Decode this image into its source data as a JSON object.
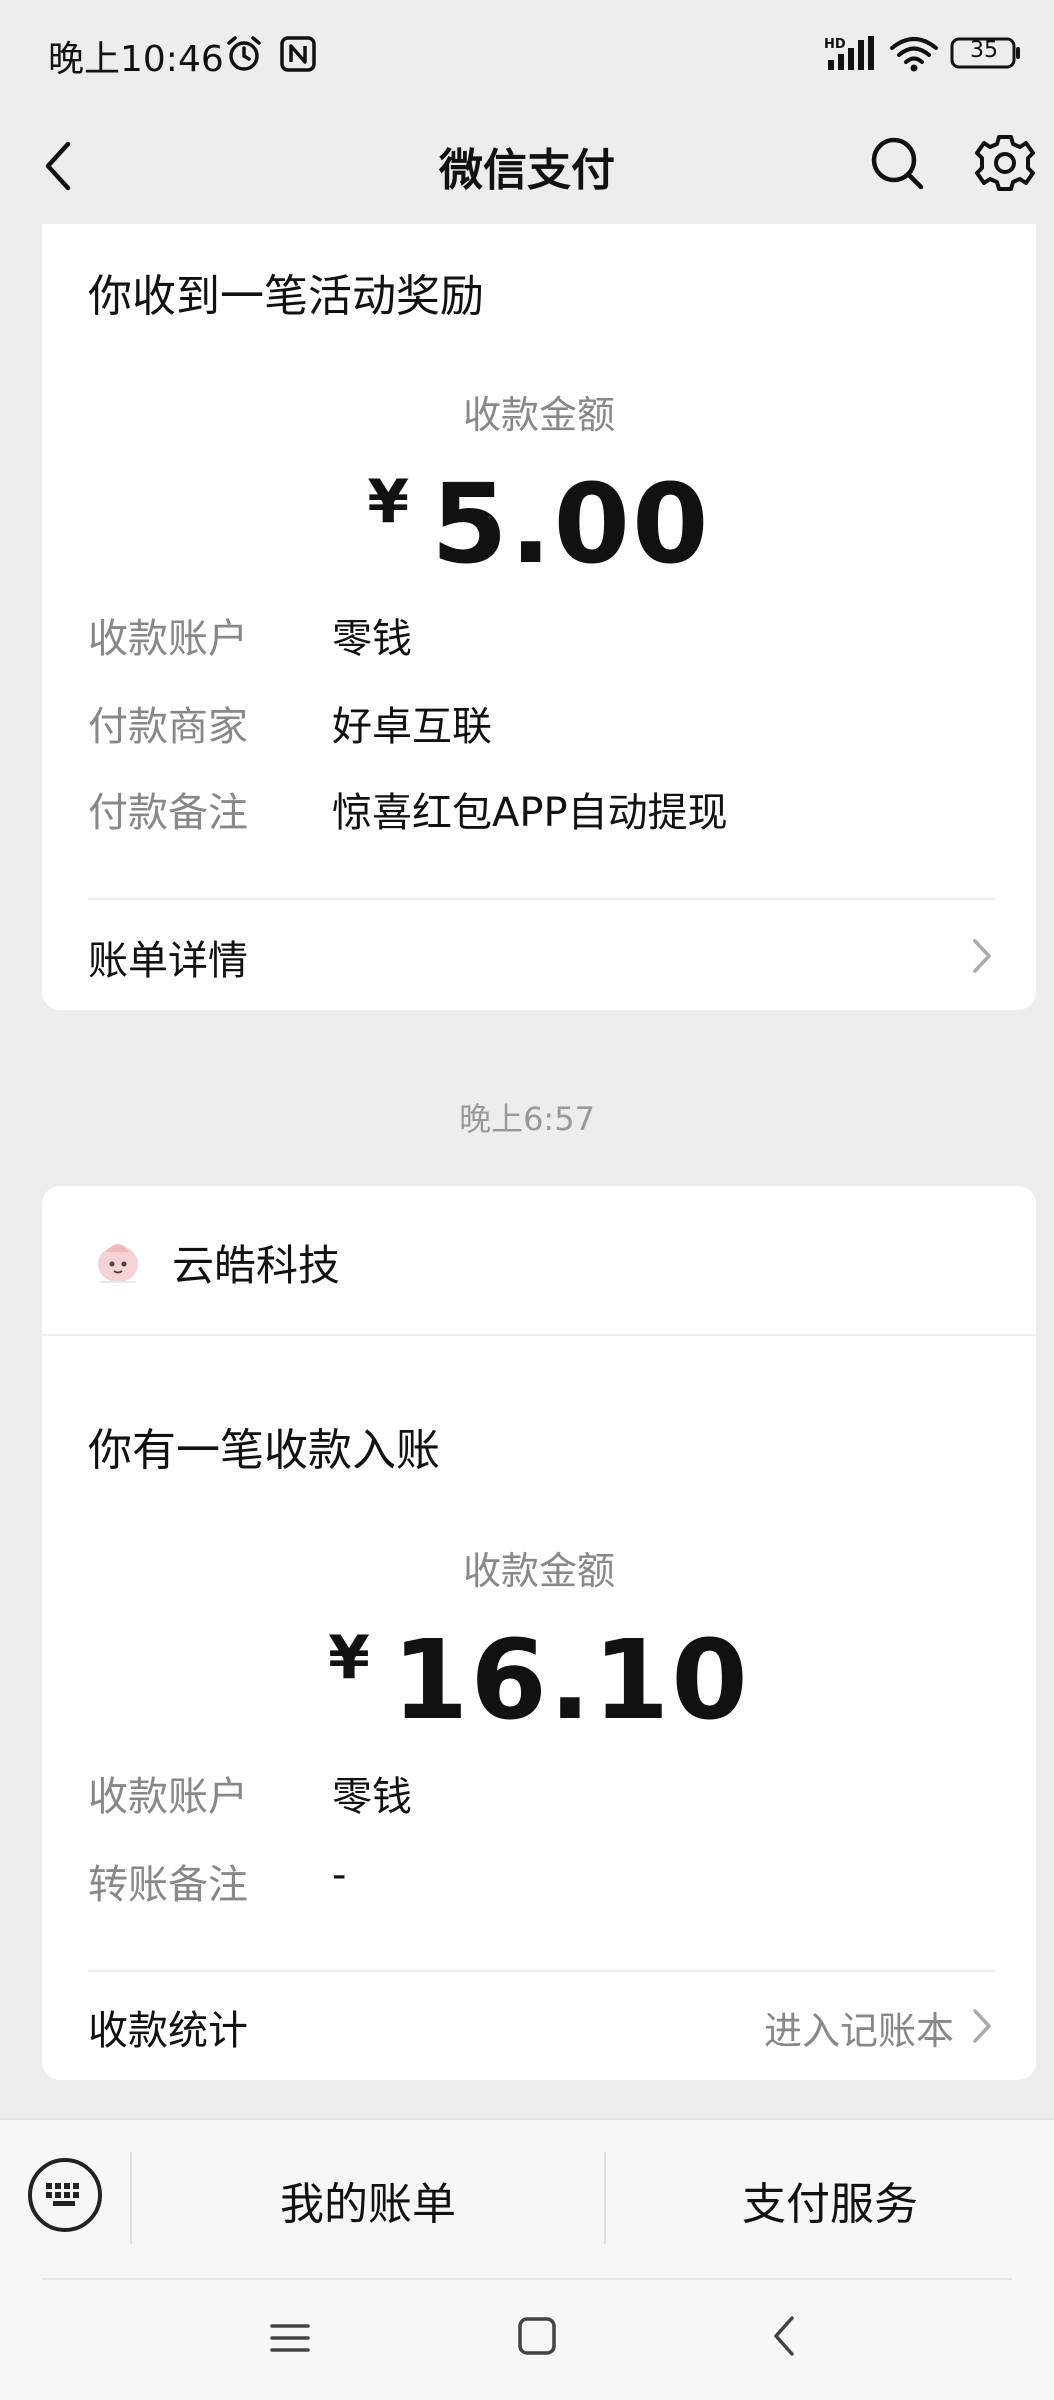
{
  "status_bar": {
    "time": "晚上10:46",
    "battery": "35",
    "icons": [
      "alarm-icon",
      "nfc-icon",
      "signal-icon",
      "wifi-icon",
      "battery-icon"
    ]
  },
  "nav": {
    "title": "微信支付",
    "icons": [
      "back-icon",
      "search-icon",
      "settings-icon"
    ]
  },
  "card1": {
    "heading": "你收到一笔活动奖励",
    "amount_label": "收款金额",
    "currency": "¥",
    "amount": "5.00",
    "rows": [
      {
        "label": "收款账户",
        "value": "零钱"
      },
      {
        "label": "付款商家",
        "value": "好卓互联"
      },
      {
        "label": "付款备注",
        "value": "惊喜红包APP自动提现"
      }
    ],
    "footer_label": "账单详情"
  },
  "timestamp": "晚上6:57",
  "card2": {
    "merchant_name": "云皓科技",
    "heading": "你有一笔收款入账",
    "amount_label": "收款金额",
    "currency": "¥",
    "amount": "16.10",
    "rows": [
      {
        "label": "收款账户",
        "value": "零钱"
      },
      {
        "label": "转账备注",
        "value": "-"
      }
    ],
    "footer_label": "收款统计",
    "footer_link": "进入记账本"
  },
  "bottom_bar": {
    "my_bills": "我的账单",
    "pay_services": "支付服务"
  },
  "colors": {
    "background": "#ededed",
    "card": "#ffffff",
    "secondary_text": "#888888"
  }
}
